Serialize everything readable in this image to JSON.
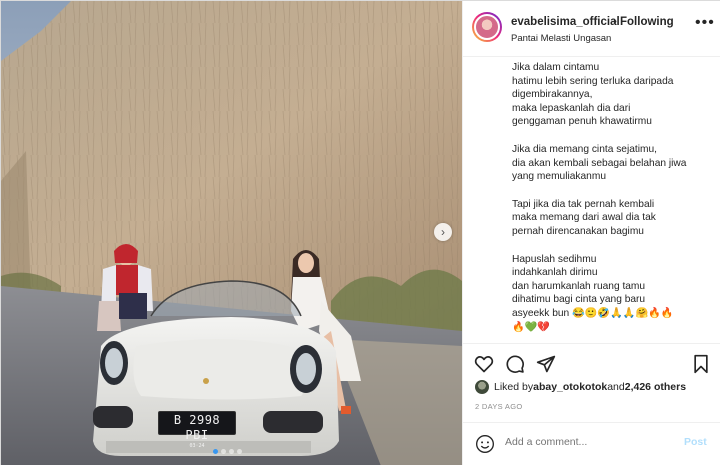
{
  "post": {
    "author": {
      "username": "evabelisima_official",
      "separator": "•",
      "follow_status": "Following",
      "location": "Pantai Melasti Ungasan",
      "more_icon": "more-horizontal-icon"
    },
    "photo": {
      "license_plate": "B 2998 PBI",
      "license_plate_sub": "03·24",
      "next_icon": "chevron-right-icon",
      "carousel_dots": 4,
      "active_dot": 1
    },
    "caption": {
      "lines": [
        "Jika dalam cintamu",
        "hatimu lebih sering terluka daripada",
        "digembirakannya,",
        "maka lepaskanlah dia dari",
        "genggaman penuh khawatirmu",
        "",
        "Jika dia memang cinta sejatimu,",
        "dia akan kembali sebagai belahan jiwa",
        "yang memuliakanmu",
        "",
        "Tapi jika dia tak pernah kembali",
        "maka memang dari awal dia tak",
        "pernah direncanakan bagimu",
        "",
        "Hapuslah sedihmu",
        "indahkanlah dirimu",
        "dan harumkanlah ruang tamu",
        "dihatimu bagi cinta yang baru",
        "asyeekk bun 😂🙂🤣🙏🙏🤗🔥🔥",
        "🔥💚💔"
      ]
    },
    "actions": {
      "like_icon": "heart-icon",
      "comment_icon": "comment-icon",
      "share_icon": "paper-plane-icon",
      "save_icon": "bookmark-icon"
    },
    "likes": {
      "prefix": "Liked by ",
      "user": "abay_otokotok",
      "middle": " and ",
      "count": "2,426 others"
    },
    "timestamp": "2 DAYS AGO",
    "comment": {
      "emoji_icon": "smiley-icon",
      "placeholder": "Add a comment...",
      "post_label": "Post"
    },
    "colors": {
      "accent": "#3897f0",
      "post_disabled": "#b2dffc",
      "muted": "#8e8e8e",
      "text": "#262626"
    }
  }
}
